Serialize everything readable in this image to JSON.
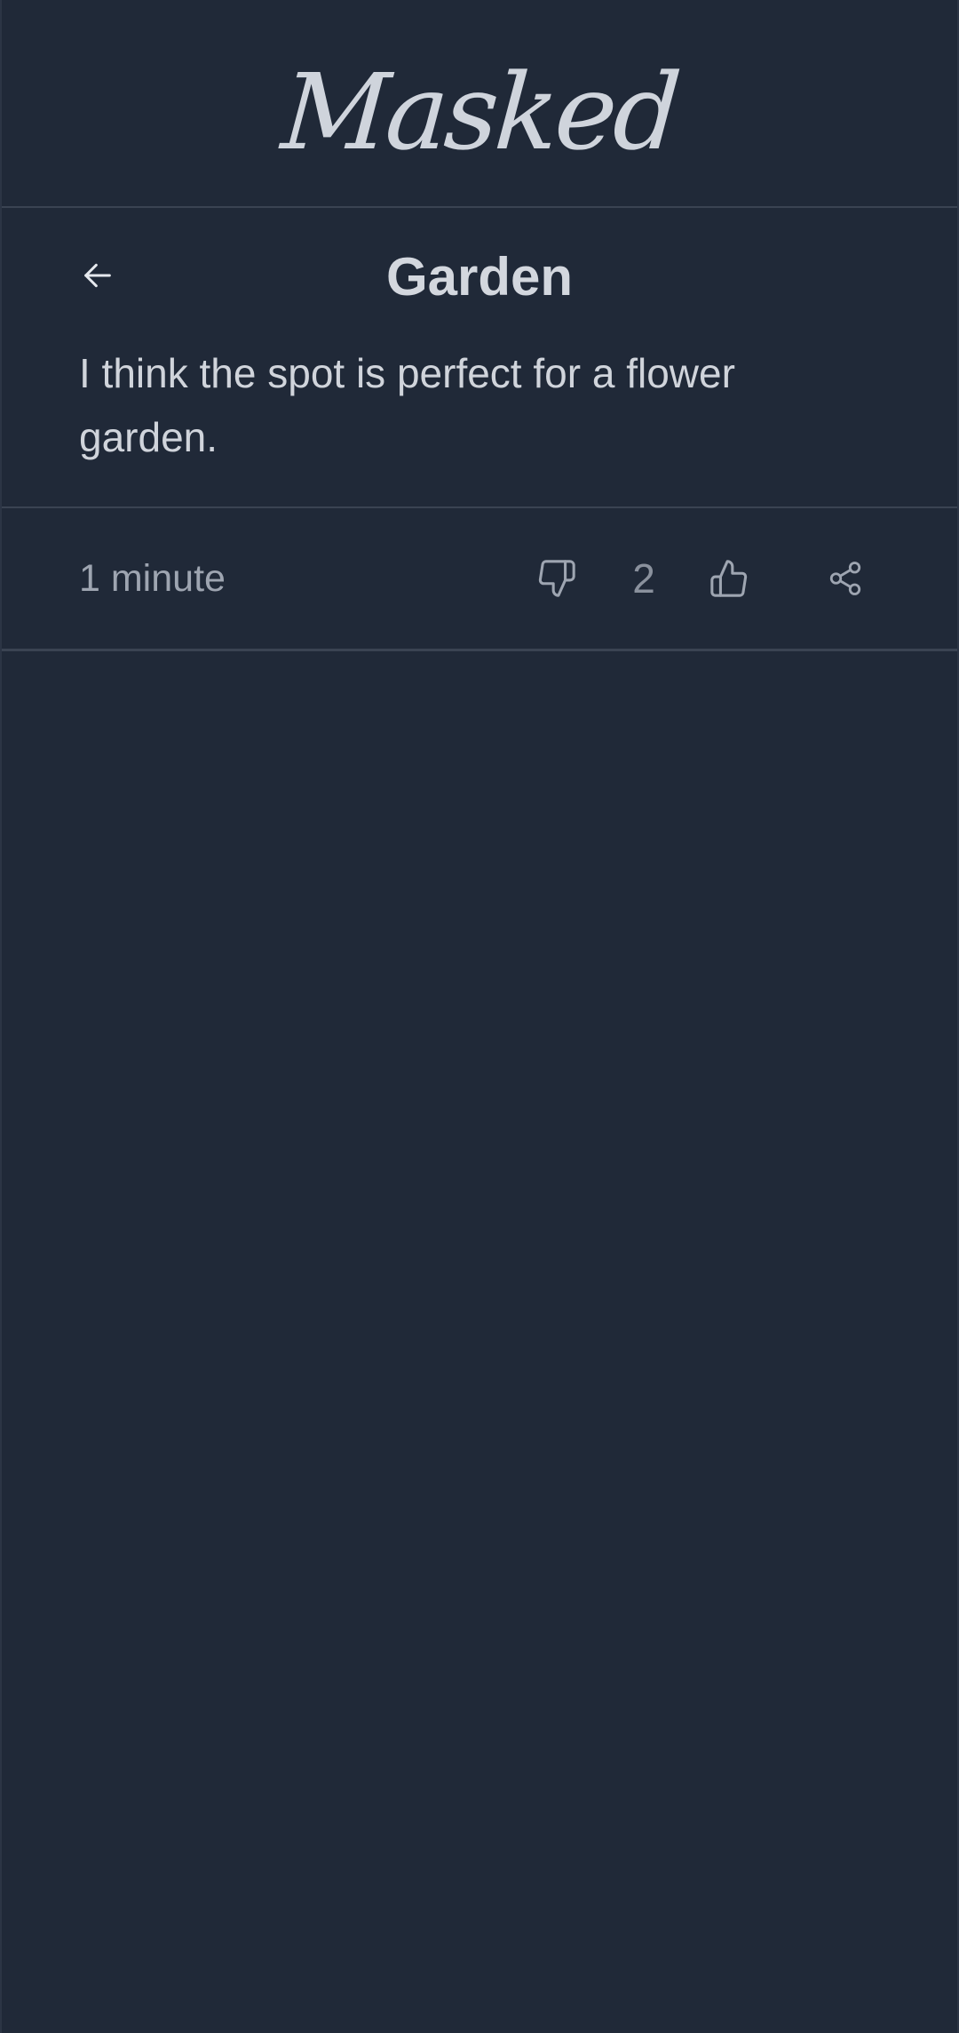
{
  "app": {
    "brand": "Masked"
  },
  "post": {
    "title": "Garden",
    "body": "I think the spot is perfect for a flower garden.",
    "time": "1 minute",
    "score": "2"
  },
  "icons": {
    "back": "arrow-left-icon",
    "dislike": "thumbs-down-icon",
    "like": "thumbs-up-icon",
    "share": "share-icon"
  },
  "colors": {
    "background": "#202938",
    "divider": "#3a4352",
    "text_primary": "#d3d7de",
    "text_muted": "#9ea5b1"
  }
}
